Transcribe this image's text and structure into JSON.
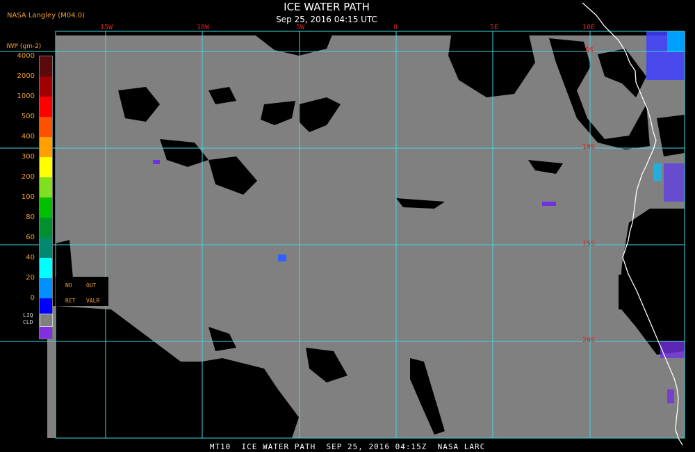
{
  "header": {
    "org": "NASA Langley (M04.0)",
    "title": "ICE WATER PATH",
    "subtitle": "Sep 25, 2016 04:15 UTC"
  },
  "footer": "MT10  ICE WATER PATH  SEP 25, 2016 04:15Z  NASA LARC",
  "grid": {
    "longitudes": [
      "15W",
      "10W",
      "5W",
      "0",
      "5E",
      "10E"
    ],
    "latitudes": [
      "5S",
      "10S",
      "15S",
      "20S"
    ]
  },
  "legend": {
    "unit": "IWP (gm-2)",
    "levels": [
      "4000",
      "2000",
      "1000",
      "500",
      "400",
      "300",
      "200",
      "100",
      "80",
      "60",
      "40",
      "20",
      "0"
    ],
    "colors": [
      "#5a0a0a",
      "#a00000",
      "#ff0000",
      "#ff5000",
      "#ffa000",
      "#ffff00",
      "#80e020",
      "#00c000",
      "#009030",
      "#008870",
      "#00ffff",
      "#0090ff",
      "#0000ff",
      "#8030e0"
    ],
    "no_retrieval": {
      "line1_a": "NO",
      "line1_b": "OUT",
      "line2_a": "RET",
      "line2_b": "VALR"
    },
    "liquid_cloud": {
      "line1": "LIQ",
      "line2": "CLD",
      "color": "#808080"
    }
  },
  "colors": {
    "background": "#000000",
    "liquid_cloud": "#808080",
    "gridline": "#40d8e0",
    "coast": "#ffffff",
    "label_orange": "#f0a030",
    "label_red": "#e02020"
  }
}
